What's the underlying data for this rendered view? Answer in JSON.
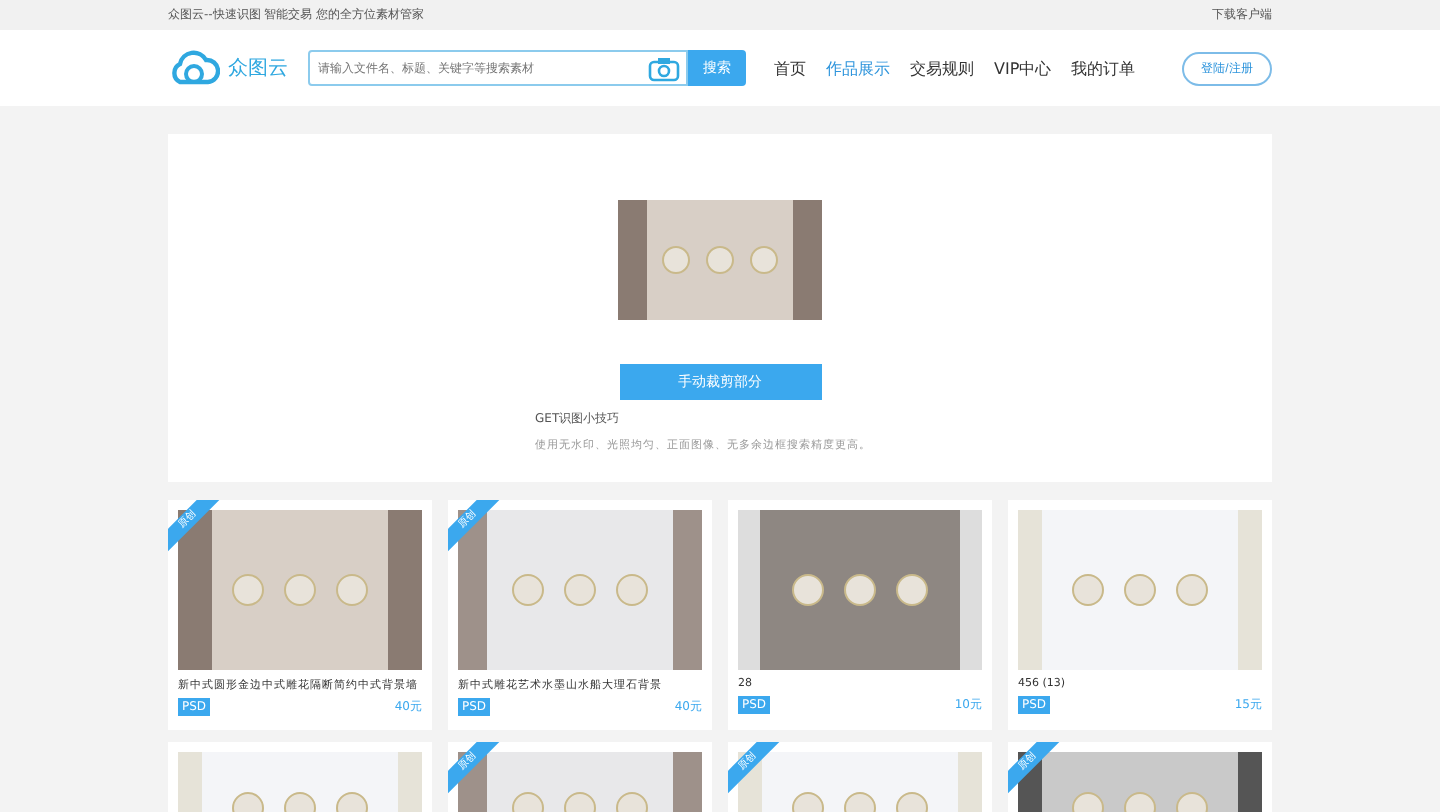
{
  "top_bar": {
    "slogan": "众图云--快速识图 智能交易 您的全方位素材管家",
    "download": "下载客户端"
  },
  "header": {
    "logo": "众图云",
    "search": {
      "placeholder": "请输入文件名、标题、关键字等搜索素材",
      "button": "搜索"
    },
    "nav": [
      {
        "label": "首页",
        "selected": false
      },
      {
        "label": "作品展示",
        "selected": true
      },
      {
        "label": "交易规则",
        "selected": false
      },
      {
        "label": "VIP中心",
        "selected": false
      },
      {
        "label": "我的订单",
        "selected": false
      }
    ],
    "login": "登陆/注册"
  },
  "upload": {
    "button": "手动裁剪部分",
    "tip_title": "GET识图小技巧",
    "tip_text": "使用无水印、光照均匀、正面图像、无多余边框搜索精度更高。"
  },
  "cards": [
    {
      "kind": "full",
      "ribbon": "原创",
      "title": "新中式圆形金边中式雕花隔断简约中式背景墙",
      "format": "PSD",
      "price": "40元"
    },
    {
      "kind": "full",
      "ribbon": "原创",
      "title": "新中式雕花艺术水墨山水船大理石背景",
      "format": "PSD",
      "price": "40元"
    },
    {
      "kind": "full",
      "title": "28",
      "format": "PSD",
      "price": "10元"
    },
    {
      "kind": "full",
      "title": "456 (13)",
      "format": "PSD",
      "price": "15元"
    },
    {
      "kind": "cut"
    },
    {
      "kind": "cut",
      "ribbon": "原创"
    },
    {
      "kind": "cut",
      "ribbon": "原创"
    },
    {
      "kind": "cut",
      "ribbon": "原创"
    }
  ]
}
